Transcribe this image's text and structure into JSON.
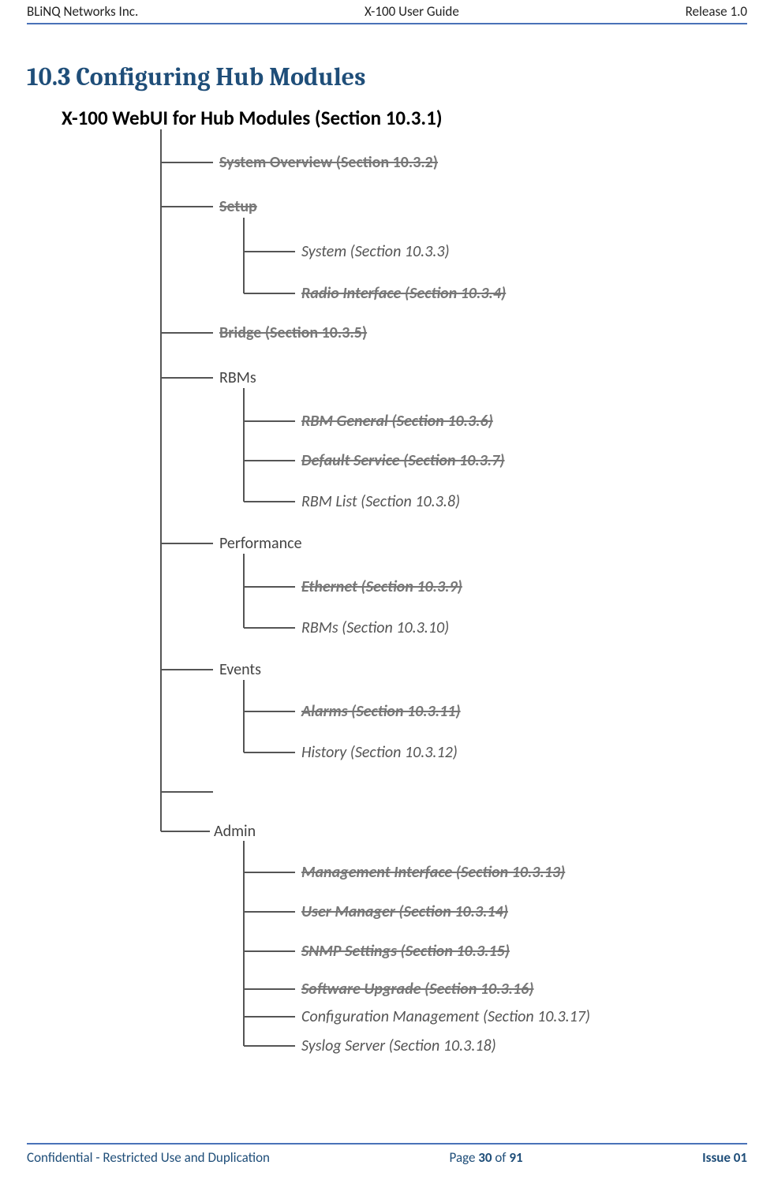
{
  "header": {
    "left": "BLiNQ Networks Inc.",
    "center": "X-100 User Guide",
    "right": "Release 1.0"
  },
  "section_heading": "10.3 Configuring Hub Modules",
  "tree": {
    "root": "X-100 WebUI for Hub Modules (Section 10.3.1)",
    "n1": "System Overview (Section 10.3.2)",
    "n2": "Setup",
    "n2a": "System (Section 10.3.3)",
    "n2b": "Radio Interface (Section 10.3.4)",
    "n3": "Bridge (Section 10.3.5)",
    "n4": "RBMs",
    "n4a": "RBM General (Section 10.3.6)",
    "n4b": "Default Service (Section 10.3.7)",
    "n4c": "RBM List (Section 10.3.8)",
    "n5": "Performance",
    "n5a": "Ethernet (Section 10.3.9)",
    "n5b": "RBMs (Section 10.3.10)",
    "n6": "Events",
    "n6a": "Alarms (Section 10.3.11)",
    "n6b": "History (Section 10.3.12)",
    "n7": "Admin",
    "n7a": "Management Interface (Section 10.3.13)",
    "n7b": "User Manager (Section 10.3.14)",
    "n7c": "SNMP Settings (Section 10.3.15)",
    "n7d": "Software Upgrade (Section 10.3.16)",
    "n7e": "Configuration Management (Section 10.3.17)",
    "n7f": "Syslog Server (Section 10.3.18)"
  },
  "footer": {
    "left": "Confidential - Restricted Use and Duplication",
    "center_prefix": "Page ",
    "center_page": "30",
    "center_mid": " of ",
    "center_total": "91",
    "right": "Issue 01"
  }
}
